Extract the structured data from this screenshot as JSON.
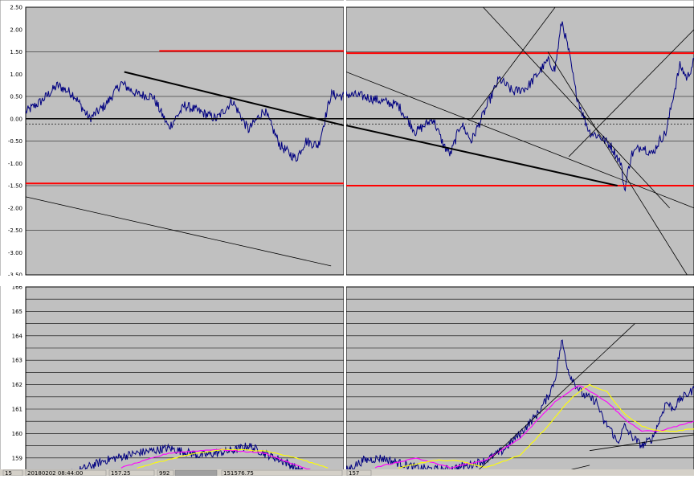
{
  "chart_data": [
    {
      "type": "line",
      "panel": "top-left",
      "y_ticks": [
        "2.50",
        "2.00",
        "1.50",
        "1.00",
        "0.50",
        "0.00",
        "-0.50",
        "-1.00",
        "-1.50",
        "-2.00",
        "-2.50",
        "-3.00",
        "-3.50"
      ],
      "ylim": [
        -3.5,
        2.5
      ],
      "grid": true,
      "series": [
        {
          "color": "#000080",
          "keypoints": [
            [
              0,
              0.15
            ],
            [
              0.05,
              0.4
            ],
            [
              0.1,
              0.75
            ],
            [
              0.15,
              0.55
            ],
            [
              0.2,
              0.0
            ],
            [
              0.25,
              0.3
            ],
            [
              0.3,
              0.8
            ],
            [
              0.35,
              0.55
            ],
            [
              0.4,
              0.5
            ],
            [
              0.45,
              -0.2
            ],
            [
              0.5,
              0.3
            ],
            [
              0.55,
              0.15
            ],
            [
              0.6,
              0.0
            ],
            [
              0.65,
              0.4
            ],
            [
              0.7,
              -0.25
            ],
            [
              0.75,
              0.2
            ],
            [
              0.8,
              -0.6
            ],
            [
              0.85,
              -0.9
            ],
            [
              0.88,
              -0.5
            ],
            [
              0.92,
              -0.6
            ],
            [
              0.96,
              0.55
            ],
            [
              1.0,
              0.5
            ]
          ]
        }
      ],
      "hlines": [
        {
          "y": 1.52,
          "color": "#ff0000",
          "x0": 0.42,
          "x1": 1.0
        },
        {
          "y": -1.45,
          "color": "#ff0000",
          "x0": 0.0,
          "x1": 1.0
        },
        {
          "y": 0.0,
          "color": "#000000",
          "x0": 0.0,
          "x1": 1.0
        }
      ],
      "trendlines": [
        {
          "x0": 0.31,
          "y0": 1.05,
          "x1": 1.0,
          "y1": -0.15,
          "color": "#000000",
          "heavy": true
        },
        {
          "x0": 0.0,
          "y0": -1.75,
          "x1": 0.96,
          "y1": -3.3,
          "color": "#000000",
          "heavy": false
        }
      ]
    },
    {
      "type": "line",
      "panel": "top-right",
      "y_ticks": [],
      "ylim": [
        -3.5,
        2.5
      ],
      "grid": true,
      "series": [
        {
          "color": "#000080",
          "keypoints": [
            [
              0,
              0.55
            ],
            [
              0.05,
              0.5
            ],
            [
              0.1,
              0.4
            ],
            [
              0.15,
              0.3
            ],
            [
              0.2,
              -0.3
            ],
            [
              0.25,
              0.0
            ],
            [
              0.28,
              -0.6
            ],
            [
              0.3,
              -0.8
            ],
            [
              0.33,
              -0.1
            ],
            [
              0.36,
              -0.5
            ],
            [
              0.4,
              0.2
            ],
            [
              0.44,
              0.9
            ],
            [
              0.48,
              0.6
            ],
            [
              0.52,
              0.7
            ],
            [
              0.55,
              1.0
            ],
            [
              0.58,
              1.3
            ],
            [
              0.6,
              1.1
            ],
            [
              0.62,
              2.2
            ],
            [
              0.64,
              1.5
            ],
            [
              0.66,
              0.6
            ],
            [
              0.68,
              0.1
            ],
            [
              0.7,
              -0.3
            ],
            [
              0.73,
              -0.4
            ],
            [
              0.76,
              -0.6
            ],
            [
              0.79,
              -1.0
            ],
            [
              0.8,
              -1.6
            ],
            [
              0.82,
              -0.8
            ],
            [
              0.85,
              -0.6
            ],
            [
              0.88,
              -0.8
            ],
            [
              0.9,
              -0.5
            ],
            [
              0.92,
              -0.3
            ],
            [
              0.94,
              0.5
            ],
            [
              0.96,
              1.2
            ],
            [
              0.98,
              0.9
            ],
            [
              1.0,
              1.3
            ]
          ]
        }
      ],
      "hlines": [
        {
          "y": 1.47,
          "color": "#ff0000",
          "x0": 0.0,
          "x1": 1.0
        },
        {
          "y": -1.5,
          "color": "#ff0000",
          "x0": 0.0,
          "x1": 1.0
        },
        {
          "y": 0.0,
          "color": "#000000",
          "x0": 0.0,
          "x1": 1.0
        }
      ],
      "trendlines": [
        {
          "x0": 0.0,
          "y0": -0.15,
          "x1": 0.78,
          "y1": -1.5,
          "color": "#000000",
          "heavy": true
        },
        {
          "x0": 0.0,
          "y0": 1.05,
          "x1": 1.0,
          "y1": -2.0,
          "color": "#000000",
          "heavy": false
        },
        {
          "x0": 0.36,
          "y0": 0.0,
          "x1": 0.62,
          "y1": 2.7,
          "color": "#000000",
          "heavy": false
        },
        {
          "x0": 0.37,
          "y0": 2.7,
          "x1": 0.93,
          "y1": -2.0,
          "color": "#000000",
          "heavy": false
        },
        {
          "x0": 0.58,
          "y0": 1.5,
          "x1": 0.98,
          "y1": -3.5,
          "color": "#000000",
          "heavy": false
        },
        {
          "x0": 0.64,
          "y0": -0.85,
          "x1": 1.0,
          "y1": 2.0,
          "color": "#000000",
          "heavy": false
        }
      ]
    },
    {
      "type": "line",
      "panel": "bottom-left",
      "y_ticks": [
        "166",
        "165",
        "164",
        "163",
        "162",
        "161",
        "160",
        "159"
      ],
      "ylim": [
        158.5,
        166.0
      ],
      "grid": true,
      "series": [
        {
          "color": "#000080",
          "keypoints": [
            [
              0,
              157.8
            ],
            [
              0.08,
              158.0
            ],
            [
              0.15,
              158.4
            ],
            [
              0.25,
              158.9
            ],
            [
              0.35,
              159.2
            ],
            [
              0.45,
              159.4
            ],
            [
              0.55,
              159.1
            ],
            [
              0.65,
              159.3
            ],
            [
              0.7,
              159.5
            ],
            [
              0.75,
              159.2
            ],
            [
              0.82,
              158.8
            ],
            [
              0.9,
              158.2
            ],
            [
              1.0,
              158.0
            ]
          ]
        },
        {
          "color": "#ff00ff",
          "keypoints": [
            [
              0.3,
              158.6
            ],
            [
              0.45,
              159.2
            ],
            [
              0.6,
              159.35
            ],
            [
              0.75,
              159.2
            ],
            [
              0.85,
              158.7
            ],
            [
              0.9,
              158.5
            ]
          ]
        },
        {
          "color": "#ffff00",
          "keypoints": [
            [
              0.35,
              158.6
            ],
            [
              0.5,
              159.1
            ],
            [
              0.62,
              159.35
            ],
            [
              0.75,
              159.3
            ],
            [
              0.85,
              159.0
            ],
            [
              0.95,
              158.6
            ]
          ]
        }
      ],
      "hlines": [],
      "trendlines": []
    },
    {
      "type": "line",
      "panel": "bottom-right",
      "y_ticks": [],
      "ylim": [
        158.5,
        166.0
      ],
      "grid": true,
      "series": [
        {
          "color": "#000080",
          "keypoints": [
            [
              0,
              158.5
            ],
            [
              0.05,
              158.9
            ],
            [
              0.1,
              159.0
            ],
            [
              0.15,
              158.8
            ],
            [
              0.2,
              158.6
            ],
            [
              0.28,
              158.5
            ],
            [
              0.35,
              158.7
            ],
            [
              0.4,
              158.9
            ],
            [
              0.45,
              159.3
            ],
            [
              0.5,
              160.0
            ],
            [
              0.55,
              160.8
            ],
            [
              0.58,
              161.5
            ],
            [
              0.6,
              162.2
            ],
            [
              0.62,
              163.8
            ],
            [
              0.64,
              162.5
            ],
            [
              0.66,
              162.0
            ],
            [
              0.68,
              161.6
            ],
            [
              0.72,
              161.3
            ],
            [
              0.74,
              160.5
            ],
            [
              0.76,
              160.2
            ],
            [
              0.78,
              159.6
            ],
            [
              0.8,
              160.3
            ],
            [
              0.82,
              159.9
            ],
            [
              0.85,
              159.5
            ],
            [
              0.88,
              159.8
            ],
            [
              0.9,
              160.5
            ],
            [
              0.92,
              161.3
            ],
            [
              0.94,
              161.0
            ],
            [
              0.96,
              161.4
            ],
            [
              1.0,
              161.8
            ]
          ]
        },
        {
          "color": "#ff00ff",
          "keypoints": [
            [
              0.08,
              158.6
            ],
            [
              0.2,
              159.0
            ],
            [
              0.3,
              158.6
            ],
            [
              0.4,
              158.9
            ],
            [
              0.5,
              159.8
            ],
            [
              0.6,
              161.3
            ],
            [
              0.67,
              162.0
            ],
            [
              0.75,
              161.3
            ],
            [
              0.8,
              160.6
            ],
            [
              0.85,
              160.1
            ],
            [
              0.9,
              160.1
            ],
            [
              0.95,
              160.3
            ],
            [
              1.0,
              160.5
            ]
          ]
        },
        {
          "color": "#ffff00",
          "keypoints": [
            [
              0.15,
              158.6
            ],
            [
              0.25,
              158.9
            ],
            [
              0.32,
              158.9
            ],
            [
              0.4,
              158.6
            ],
            [
              0.5,
              159.1
            ],
            [
              0.58,
              160.3
            ],
            [
              0.65,
              161.5
            ],
            [
              0.7,
              162.0
            ],
            [
              0.75,
              161.7
            ],
            [
              0.8,
              160.8
            ],
            [
              0.85,
              160.3
            ],
            [
              0.9,
              160.1
            ],
            [
              0.95,
              160.1
            ],
            [
              1.0,
              160.2
            ]
          ]
        }
      ],
      "hlines": [],
      "trendlines": [
        {
          "x0": 0.38,
          "y0": 158.5,
          "x1": 0.83,
          "y1": 164.5,
          "color": "#000000",
          "heavy": false
        },
        {
          "x0": 0.7,
          "y0": 159.3,
          "x1": 1.0,
          "y1": 159.95,
          "color": "#000000",
          "heavy": false
        },
        {
          "x0": 0.64,
          "y0": 158.5,
          "x1": 0.7,
          "y1": 158.7,
          "color": "#000000",
          "heavy": false
        }
      ]
    }
  ],
  "status_bar": {
    "cells": [
      "15",
      "20180202  08:44:00",
      "157.25",
      "992",
      "",
      "151576.75",
      "157"
    ]
  }
}
